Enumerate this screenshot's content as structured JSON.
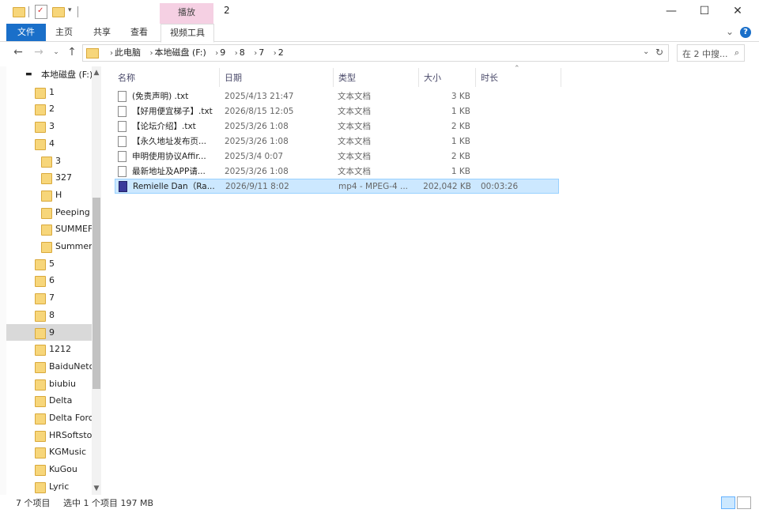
{
  "window": {
    "title": "2",
    "context_tab": "播放",
    "minimize": "—",
    "maximize": "☐",
    "close": "✕"
  },
  "ribbon": {
    "file": "文件",
    "tabs": [
      "主页",
      "共享",
      "查看"
    ],
    "video_tools": "视频工具",
    "collapse": "⌄",
    "help": "?"
  },
  "address": {
    "crumbs": [
      "此电脑",
      "本地磁盘 (F:)",
      "9",
      "8",
      "7",
      "2"
    ],
    "dropdown": "⌄",
    "refresh": "↻"
  },
  "search": {
    "placeholder": "在 2 中搜...",
    "icon": "search-icon"
  },
  "nav": {
    "items": [
      {
        "label": "本地磁盘 (F:)",
        "level": 0,
        "drive": true
      },
      {
        "label": "1",
        "level": 1
      },
      {
        "label": "2",
        "level": 1
      },
      {
        "label": "3",
        "level": 1
      },
      {
        "label": "4",
        "level": 1
      },
      {
        "label": "3",
        "level": 2
      },
      {
        "label": "327",
        "level": 2
      },
      {
        "label": "H",
        "level": 2
      },
      {
        "label": "Peeping",
        "level": 2
      },
      {
        "label": "SUMMEF",
        "level": 2
      },
      {
        "label": "Summer",
        "level": 2
      },
      {
        "label": "5",
        "level": 1
      },
      {
        "label": "6",
        "level": 1
      },
      {
        "label": "7",
        "level": 1
      },
      {
        "label": "8",
        "level": 1
      },
      {
        "label": "9",
        "level": 1,
        "selected": true
      },
      {
        "label": "1212",
        "level": 1
      },
      {
        "label": "BaiduNetc",
        "level": 1
      },
      {
        "label": "biubiu",
        "level": 1
      },
      {
        "label": "Delta",
        "level": 1
      },
      {
        "label": "Delta Forc",
        "level": 1
      },
      {
        "label": "HRSoftsto",
        "level": 1
      },
      {
        "label": "KGMusic",
        "level": 1
      },
      {
        "label": "KuGou",
        "level": 1
      },
      {
        "label": "Lyric",
        "level": 1
      }
    ]
  },
  "columns": {
    "name": "名称",
    "date": "日期",
    "type": "类型",
    "size": "大小",
    "duration": "时长"
  },
  "files": [
    {
      "name": "(免责声明) .txt",
      "date": "2025/4/13 21:47",
      "type": "文本文档",
      "size": "3 KB",
      "duration": "",
      "kind": "txt"
    },
    {
      "name": "【好用便宜梯子】.txt",
      "date": "2026/8/15 12:05",
      "type": "文本文档",
      "size": "1 KB",
      "duration": "",
      "kind": "txt"
    },
    {
      "name": "【论坛介绍】.txt",
      "date": "2025/3/26 1:08",
      "type": "文本文档",
      "size": "2 KB",
      "duration": "",
      "kind": "txt"
    },
    {
      "name": "【永久地址发布页...",
      "date": "2025/3/26 1:08",
      "type": "文本文档",
      "size": "1 KB",
      "duration": "",
      "kind": "txt"
    },
    {
      "name": "申明使用协议Affir...",
      "date": "2025/3/4 0:07",
      "type": "文本文档",
      "size": "2 KB",
      "duration": "",
      "kind": "txt"
    },
    {
      "name": "最新地址及APP请...",
      "date": "2025/3/26 1:08",
      "type": "文本文档",
      "size": "1 KB",
      "duration": "",
      "kind": "txt"
    },
    {
      "name": "Remielle Dan（Ra...",
      "date": "2026/9/11 8:02",
      "type": "mp4 - MPEG-4 ...",
      "size": "202,042 KB",
      "duration": "00:03:26",
      "kind": "video",
      "selected": true
    }
  ],
  "status": {
    "count": "7 个项目",
    "selection": "选中 1 个项目  197 MB"
  },
  "colors": {
    "accent": "#1a6fc9",
    "selection": "#cce8ff",
    "context_tab": "#f5d0e3",
    "folder": "#f7d67a"
  }
}
